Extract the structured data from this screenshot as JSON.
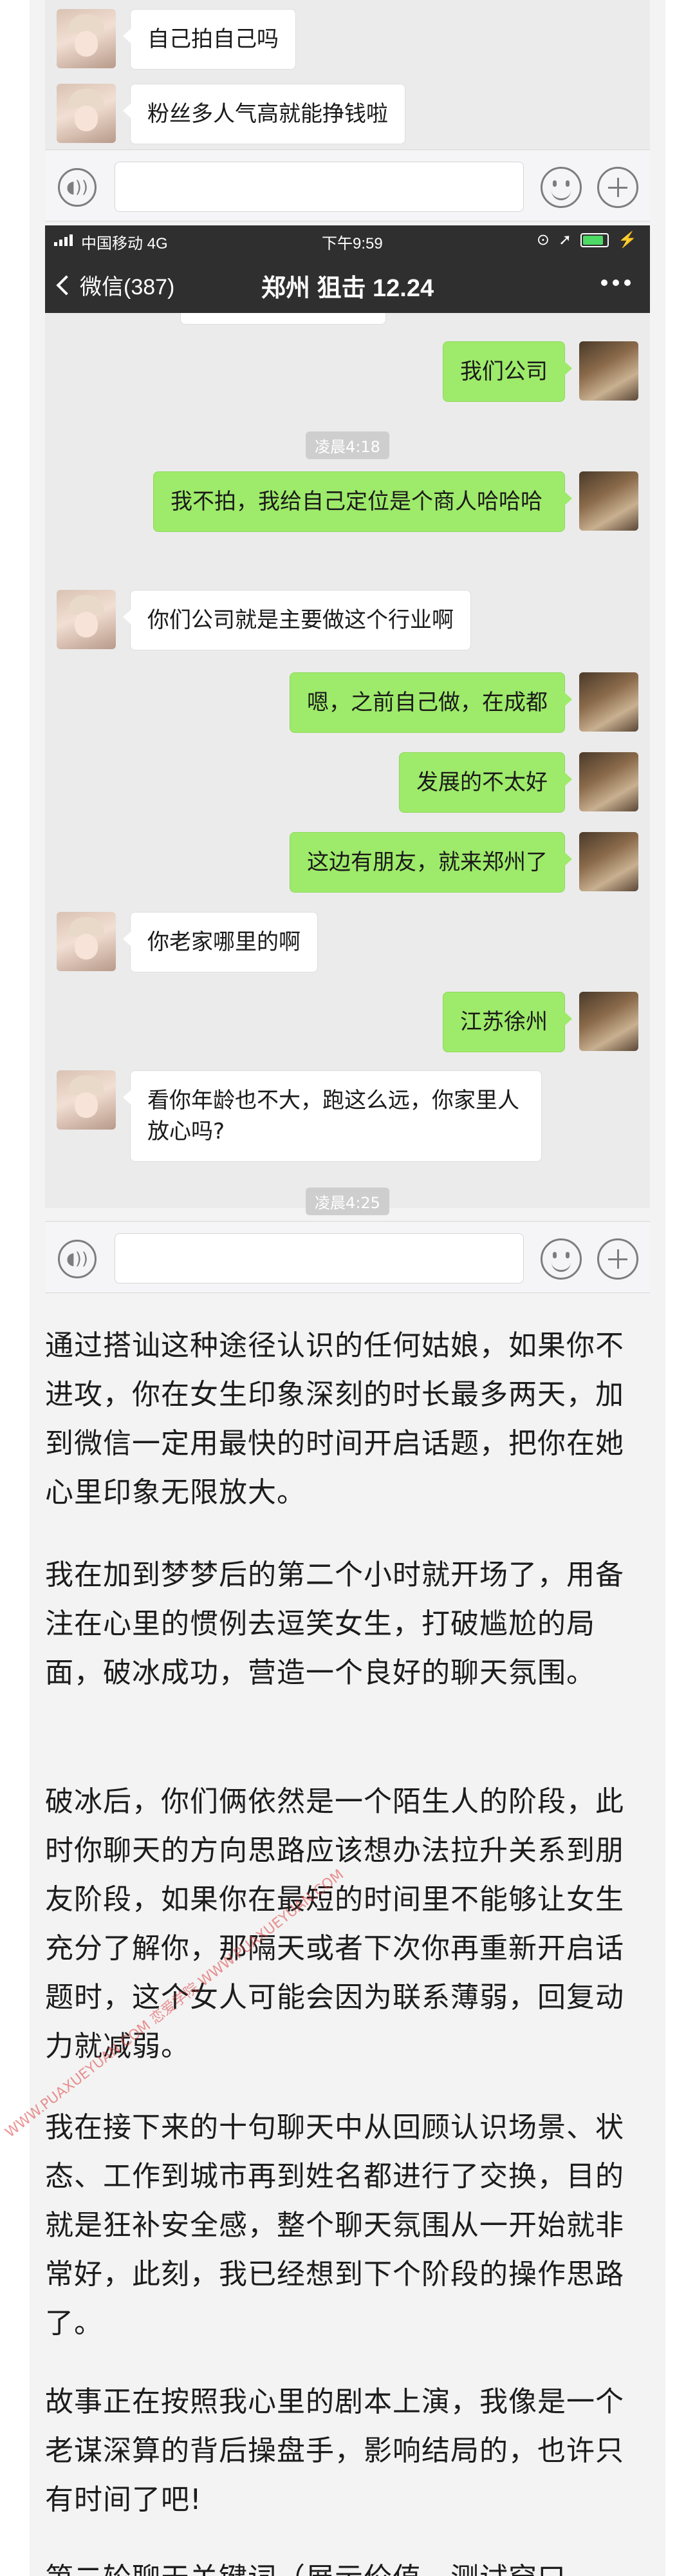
{
  "top_chat": {
    "messages": [
      {
        "side": "left",
        "text": "自己拍自己吗"
      },
      {
        "side": "left",
        "text": "粉丝多人气高就能挣钱啦"
      }
    ]
  },
  "phone": {
    "status": {
      "carrier": "中国移动  4G",
      "time": "下午9:59",
      "battery_level": 0.85
    },
    "nav": {
      "back_label": "微信(387)",
      "title": "郑州 狙击 12.24"
    }
  },
  "chat": {
    "messages": [
      {
        "side": "right",
        "text": "我们公司"
      },
      {
        "side": "time",
        "text": "凌晨4:18"
      },
      {
        "side": "right",
        "text": "我不拍，我给自己定位是个商人哈哈哈"
      },
      {
        "side": "left",
        "text": "你们公司就是主要做这个行业啊"
      },
      {
        "side": "right",
        "text": "嗯，之前自己做，在成都"
      },
      {
        "side": "right",
        "text": "发展的不太好"
      },
      {
        "side": "right",
        "text": "这边有朋友，就来郑州了"
      },
      {
        "side": "left",
        "text": "你老家哪里的啊"
      },
      {
        "side": "right",
        "text": "江苏徐州"
      },
      {
        "side": "left",
        "text": "看你年龄也不大，跑这么远，你家里人放心吗?"
      },
      {
        "side": "time",
        "text": "凌晨4:25"
      }
    ]
  },
  "article": {
    "paragraphs": [
      "通过搭讪这种途径认识的任何姑娘，如果你不进攻，你在女生印象深刻的时长最多两天，加到微信一定用最快的时间开启话题，把你在她心里印象无限放大。",
      "我在加到梦梦后的第二个小时就开场了，用备注在心里的惯例去逗笑女生，打破尴尬的局面，破冰成功，营造一个良好的聊天氛围。",
      "破冰后，你们俩依然是一个陌生人的阶段，此时你聊天的方向思路应该想办法拉升关系到朋友阶段，如果你在最短的时间里不能够让女生充分了解你，那隔天或者下次你再重新开启话题时，这个女人可能会因为联系薄弱，回复动力就减弱。",
      "我在接下来的十句聊天中从回顾认识场景、状态、工作到城市再到姓名都进行了交换，目的就是狂补安全感，整个聊天氛围从一开始就非常好，此刻，我已经想到下个阶段的操作思路了。",
      "故事正在按照我心里的剧本上演，我像是一个老谋深算的背后操盘手，影响结局的，也许只有时间了吧!",
      "第二轮聊天关键词（展示价值，测试穿口"
    ]
  },
  "watermark": "WWW.PUAXUEYUAN.COM 恋爱学院 WWW.PUAXUEYUAN.COM"
}
